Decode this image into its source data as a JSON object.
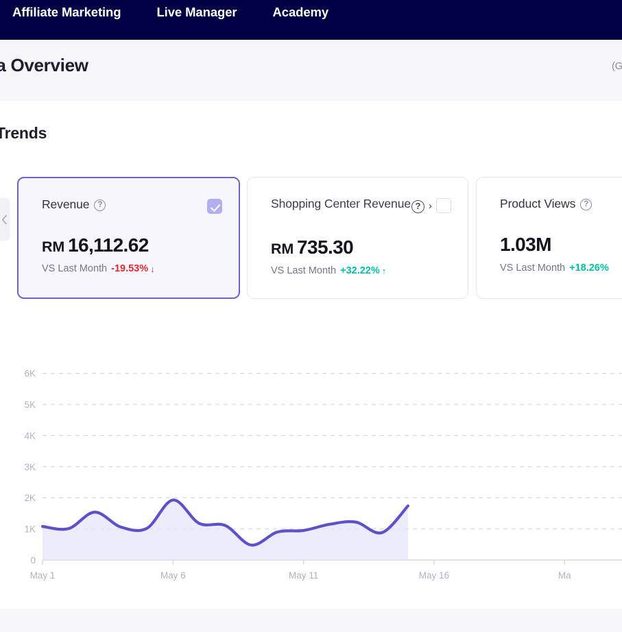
{
  "topnav": {
    "items": [
      {
        "label": "Affiliate Marketing"
      },
      {
        "label": "Live Manager"
      },
      {
        "label": "Academy"
      }
    ]
  },
  "header": {
    "title": "ta Overview",
    "timezone": "(GMT"
  },
  "section": {
    "title": "Trends"
  },
  "carousel": {
    "prev_icon": "chevron-left-icon"
  },
  "cards": [
    {
      "label": "Revenue",
      "help_icon": "question-mark-icon",
      "currency": "RM",
      "value": "16,112.62",
      "compare_label": "VS Last Month",
      "delta": "-19.53%",
      "delta_direction": "down",
      "delta_arrow": "↓",
      "delta_color": "#e02b2b",
      "selected": true,
      "checkbox_checked": true
    },
    {
      "label": "Shopping Center Revenue",
      "help_icon": "question-mark-icon",
      "chevron_icon": "chevron-right-icon",
      "currency": "RM",
      "value": "735.30",
      "compare_label": "VS Last Month",
      "delta": "+32.22%",
      "delta_direction": "up",
      "delta_arrow": "↑",
      "delta_color": "#00bfa5",
      "selected": false,
      "checkbox_checked": false
    },
    {
      "label": "Product Views",
      "help_icon": "question-mark-icon",
      "currency": "",
      "value": "1.03M",
      "compare_label": "VS Last Month",
      "delta": "+18.26%",
      "delta_direction": "up",
      "delta_arrow": "↑",
      "delta_color": "#00bfa5",
      "selected": false,
      "checkbox_checked": false
    }
  ],
  "colors": {
    "nav_bg": "#000045",
    "header_bg": "#f4f4f9",
    "accent_purple": "#5b52c9",
    "line_stroke": "#5b52c9",
    "area_fill": "#e6e4f7",
    "positive": "#00bfa5",
    "negative": "#e02b2b",
    "grid": "#dcdde4"
  },
  "chart_data": {
    "type": "area",
    "title": "",
    "xlabel": "",
    "ylabel": "",
    "ylim": [
      0,
      6500
    ],
    "grid": true,
    "legend": false,
    "ytick_labels": [
      "0",
      "1K",
      "2K",
      "3K",
      "4K",
      "5K",
      "6K"
    ],
    "ytick_values": [
      0,
      1000,
      2000,
      3000,
      4000,
      5000,
      6000
    ],
    "xtick_labels": [
      "May 1",
      "May 6",
      "May 11",
      "May 16",
      "Ma"
    ],
    "xtick_values": [
      1,
      6,
      11,
      16,
      21
    ],
    "series": [
      {
        "name": "Revenue",
        "x": [
          1,
          2,
          3,
          4,
          5,
          6,
          7,
          8,
          9,
          10,
          11,
          12,
          13,
          14,
          15
        ],
        "values": [
          1080,
          1010,
          1540,
          1060,
          1020,
          1930,
          1180,
          1110,
          480,
          900,
          950,
          1150,
          1220,
          880,
          1740
        ]
      }
    ]
  }
}
